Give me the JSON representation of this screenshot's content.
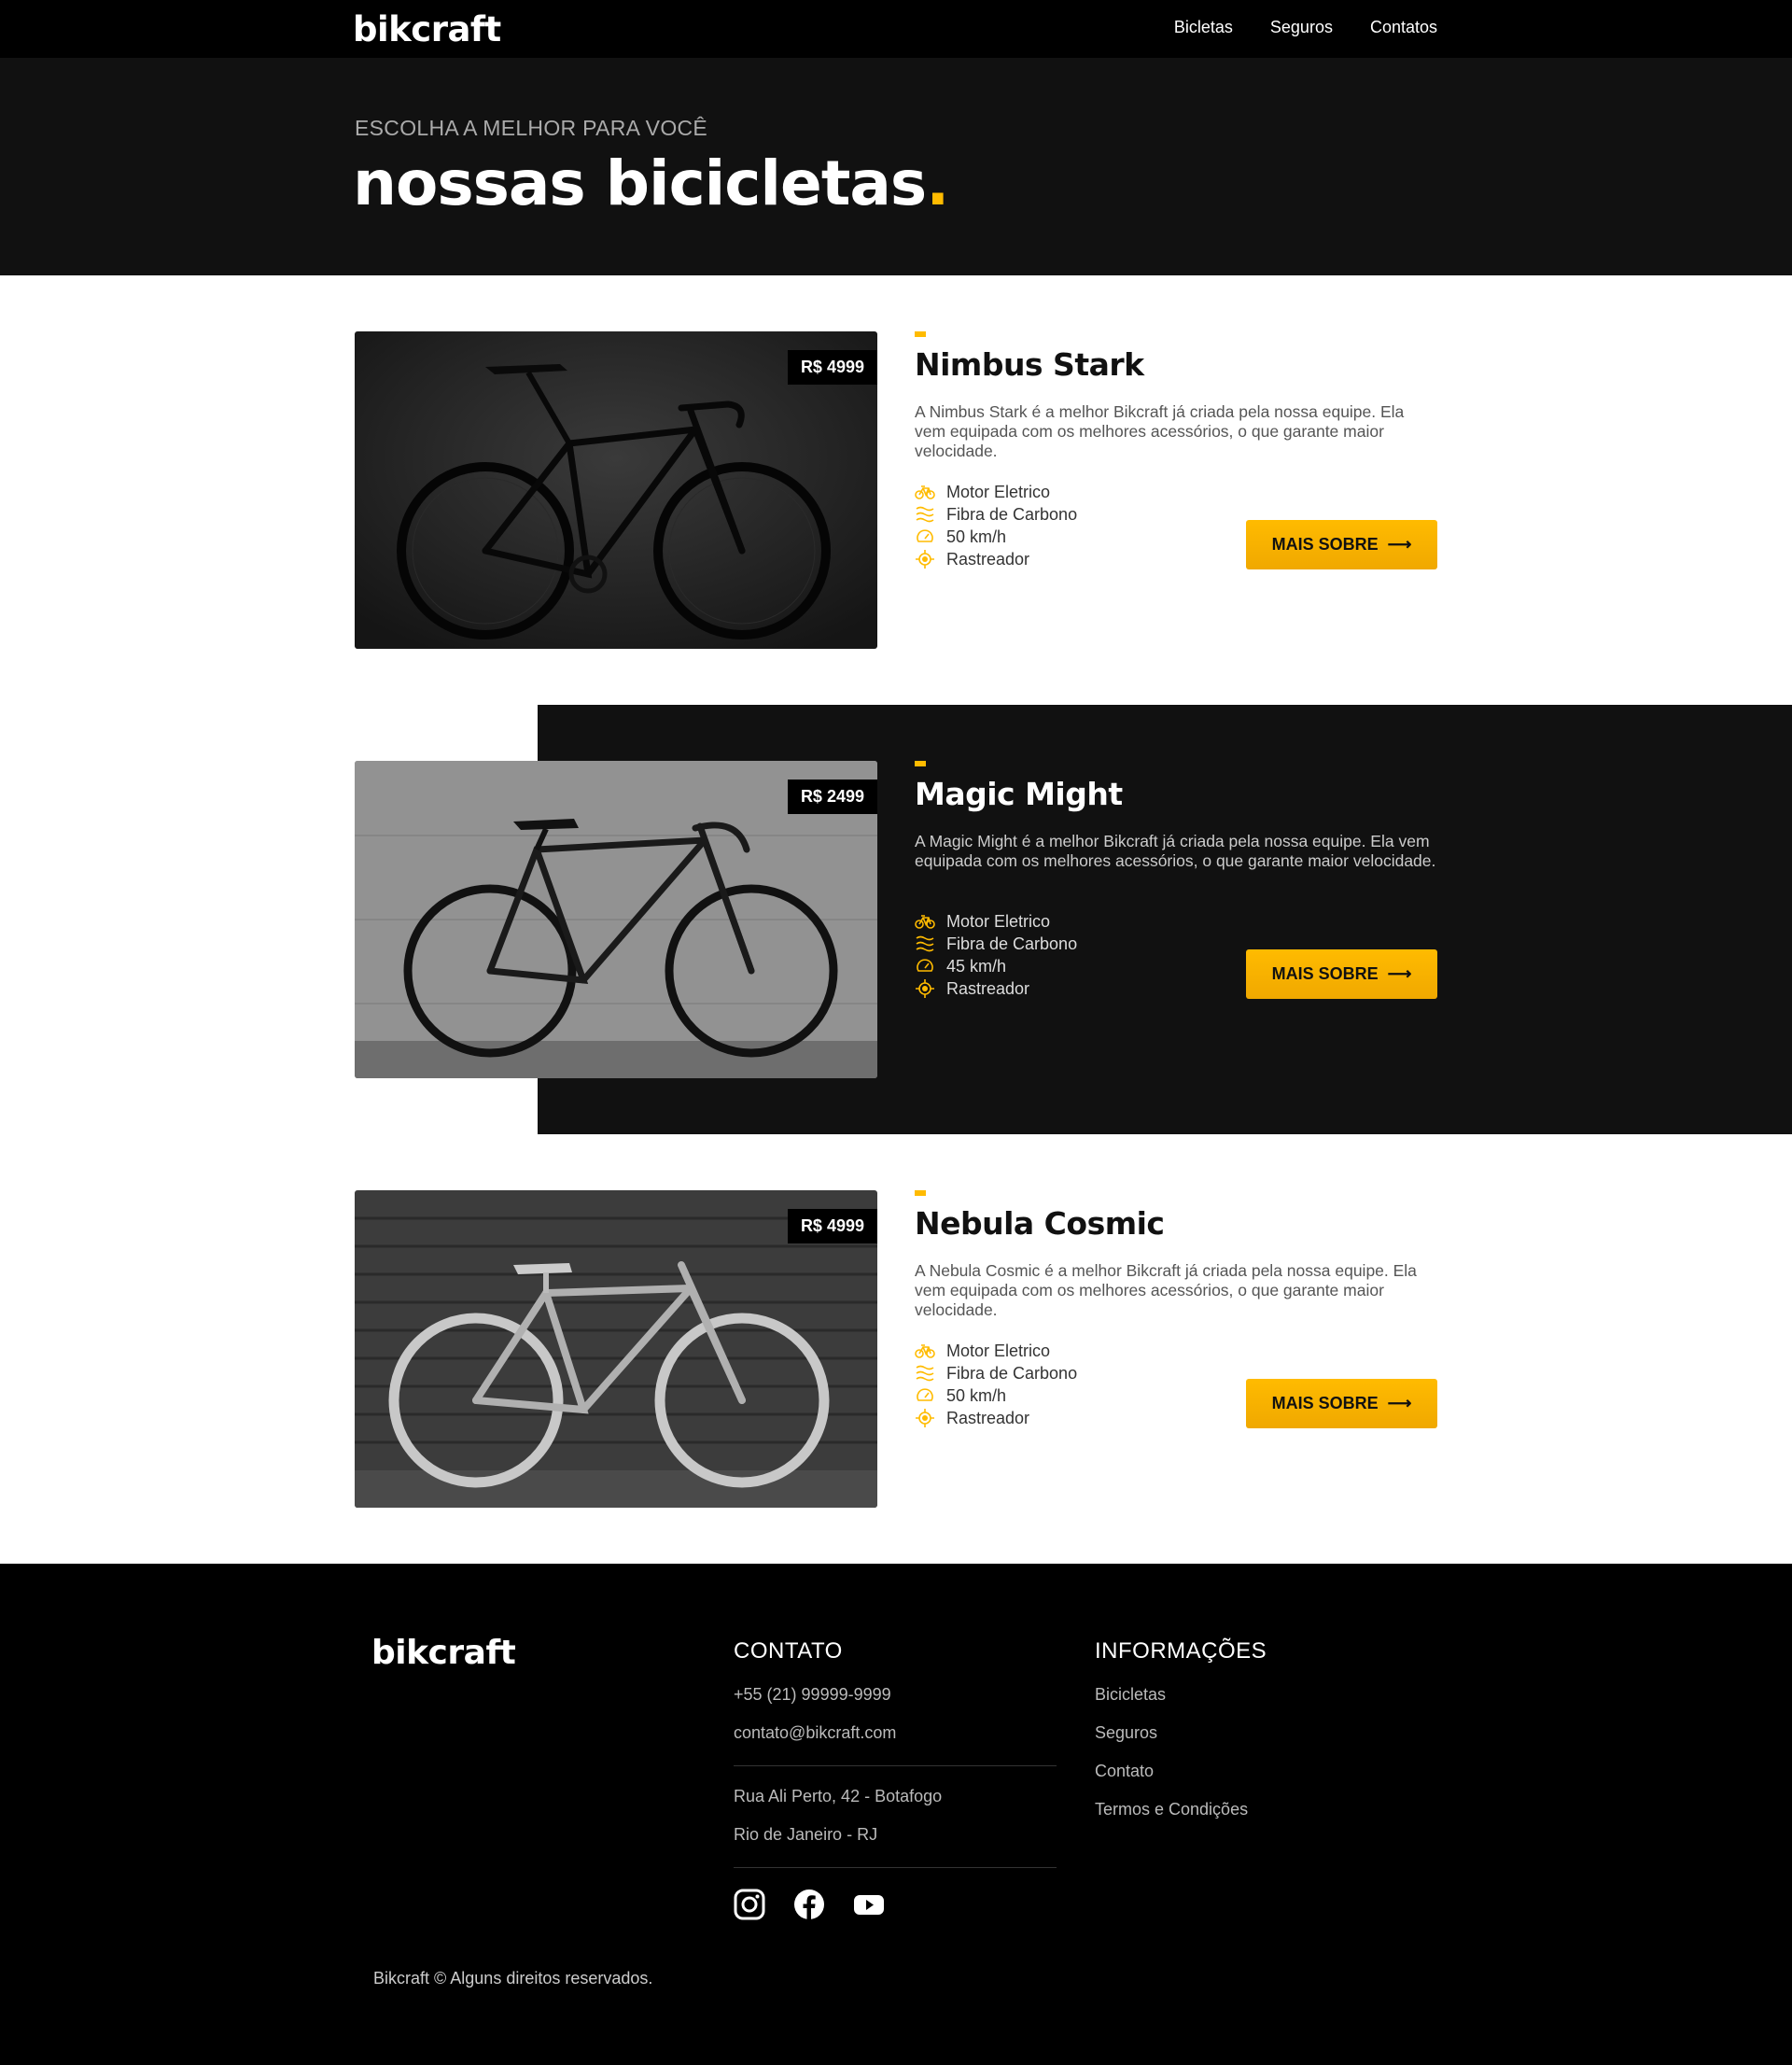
{
  "header": {
    "logo": "bikcraft",
    "nav": [
      "Bicletas",
      "Seguros",
      "Contatos"
    ]
  },
  "hero": {
    "kicker": "ESCOLHA A MELHOR PARA VOCÊ",
    "title": "nossas bicicletas",
    "title_dot": "."
  },
  "colors": {
    "accent": "#ffbb00",
    "dark": "#111111",
    "black": "#000000"
  },
  "products": [
    {
      "name": "Nimbus Stark",
      "price": "R$ 4999",
      "description": "A Nimbus Stark é a melhor Bikcraft já criada pela nossa equipe. Ela vem equipada com os melhores acessórios, o que garante maior velocidade.",
      "features": [
        "Motor Eletrico",
        "Fibra de Carbono",
        "50 km/h",
        "Rastreador"
      ],
      "button": "MAIS SOBRE",
      "image_alt": "road bike in dark studio"
    },
    {
      "name": "Magic Might",
      "price": "R$ 2499",
      "description": "A Magic Might é a melhor Bikcraft já criada pela nossa equipe. Ela vem equipada com os melhores acessórios, o que garante maior velocidade.",
      "features": [
        "Motor Eletrico",
        "Fibra de Carbono",
        "45 km/h",
        "Rastreador"
      ],
      "button": "MAIS SOBRE",
      "image_alt": "fixed gear bike against concrete wall"
    },
    {
      "name": "Nebula Cosmic",
      "price": "R$ 4999",
      "description": "A Nebula Cosmic é a melhor Bikcraft já criada pela nossa equipe. Ela vem equipada com os melhores acessórios, o que garante maior velocidade.",
      "features": [
        "Motor Eletrico",
        "Fibra de Carbono",
        "50 km/h",
        "Rastreador"
      ],
      "button": "MAIS SOBRE",
      "image_alt": "light bike against wooden wall"
    }
  ],
  "feature_icons": [
    "bike-icon",
    "carbon-icon",
    "speed-icon",
    "tracker-icon"
  ],
  "footer": {
    "logo": "bikcraft",
    "contact": {
      "heading": "CONTATO",
      "phone": "+55 (21) 99999-9999",
      "email": "contato@bikcraft.com",
      "address1": "Rua Ali Perto, 42 - Botafogo",
      "address2": "Rio de Janeiro - RJ",
      "social": [
        "instagram-icon",
        "facebook-icon",
        "youtube-icon"
      ]
    },
    "info": {
      "heading": "INFORMAÇÕES",
      "links": [
        "Bicicletas",
        "Seguros",
        "Contato",
        "Termos e Condições"
      ]
    },
    "copyright": "Bikcraft © Alguns direitos reservados."
  }
}
